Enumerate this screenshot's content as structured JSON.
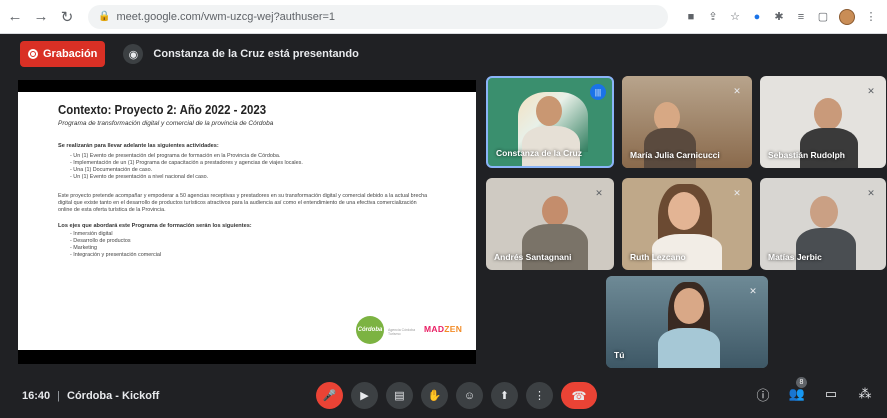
{
  "browser": {
    "back_icon": "arrow-left-icon",
    "forward_icon": "arrow-right-icon",
    "reload_icon": "reload-icon",
    "url": "meet.google.com/vwm-uzcg-wej?authuser=1"
  },
  "header": {
    "recording_label": "Grabación",
    "presenting_text": "Constanza de la Cruz está presentando"
  },
  "slide": {
    "title": "Contexto: Proyecto 2: Año 2022 - 2023",
    "subtitle": "Programa de transformación digital y comercial de la provincia de Córdoba",
    "activities_heading": "Se realizarán para llevar adelante las siguientes actividades:",
    "activities": [
      "Un (1) Evento de presentación del programa de formación en la Provincia de Córdoba.",
      "Implementación de un (1) Programa de capacitación a prestadores y agencias de viajes locales.",
      "Una (1) Documentación de caso.",
      "Un (1) Evento de presentación a nivel nacional del caso."
    ],
    "paragraph": "Este proyecto pretende acompañar y empoderar a 50 agencias receptivas y prestadores en su transformación digital y comercial debido a la actual brecha digital que existe tanto en el desarrollo de productos turísticos atractivos para la audiencia así como el entendimiento de una efectiva comercialización online de esta oferta turística de la Provincia.",
    "axes_heading": "Los ejes que abordará este Programa de formación serán los siguientes:",
    "axes": [
      "Inmersión digital",
      "Desarrollo de productos",
      "Marketing",
      "Integración y presentación comercial"
    ],
    "logo_text": "Córdoba",
    "logo_sub": "Agencia Córdoba Turismo",
    "brand_mad": "MAD",
    "brand_zen": "ZEN"
  },
  "participants": [
    {
      "name": "Constanza de la Cruz",
      "speaking": true
    },
    {
      "name": "María Julia Carnicucci",
      "muted": true
    },
    {
      "name": "Sebastián Rudolph",
      "muted": true
    },
    {
      "name": "Andrés Santagnani",
      "muted": true
    },
    {
      "name": "Ruth Lezcano",
      "muted": true
    },
    {
      "name": "Matías Jerbic",
      "muted": true
    },
    {
      "name": "Tú",
      "muted": true
    }
  ],
  "bottom": {
    "time": "16:40",
    "separator": "|",
    "meeting_name": "Córdoba - Kickoff",
    "people_count": "8"
  },
  "colors": {
    "meet_bg": "#202124",
    "record_red": "#d93025",
    "control_gray": "#3c4043",
    "speaking_blue": "#1a73e8"
  }
}
